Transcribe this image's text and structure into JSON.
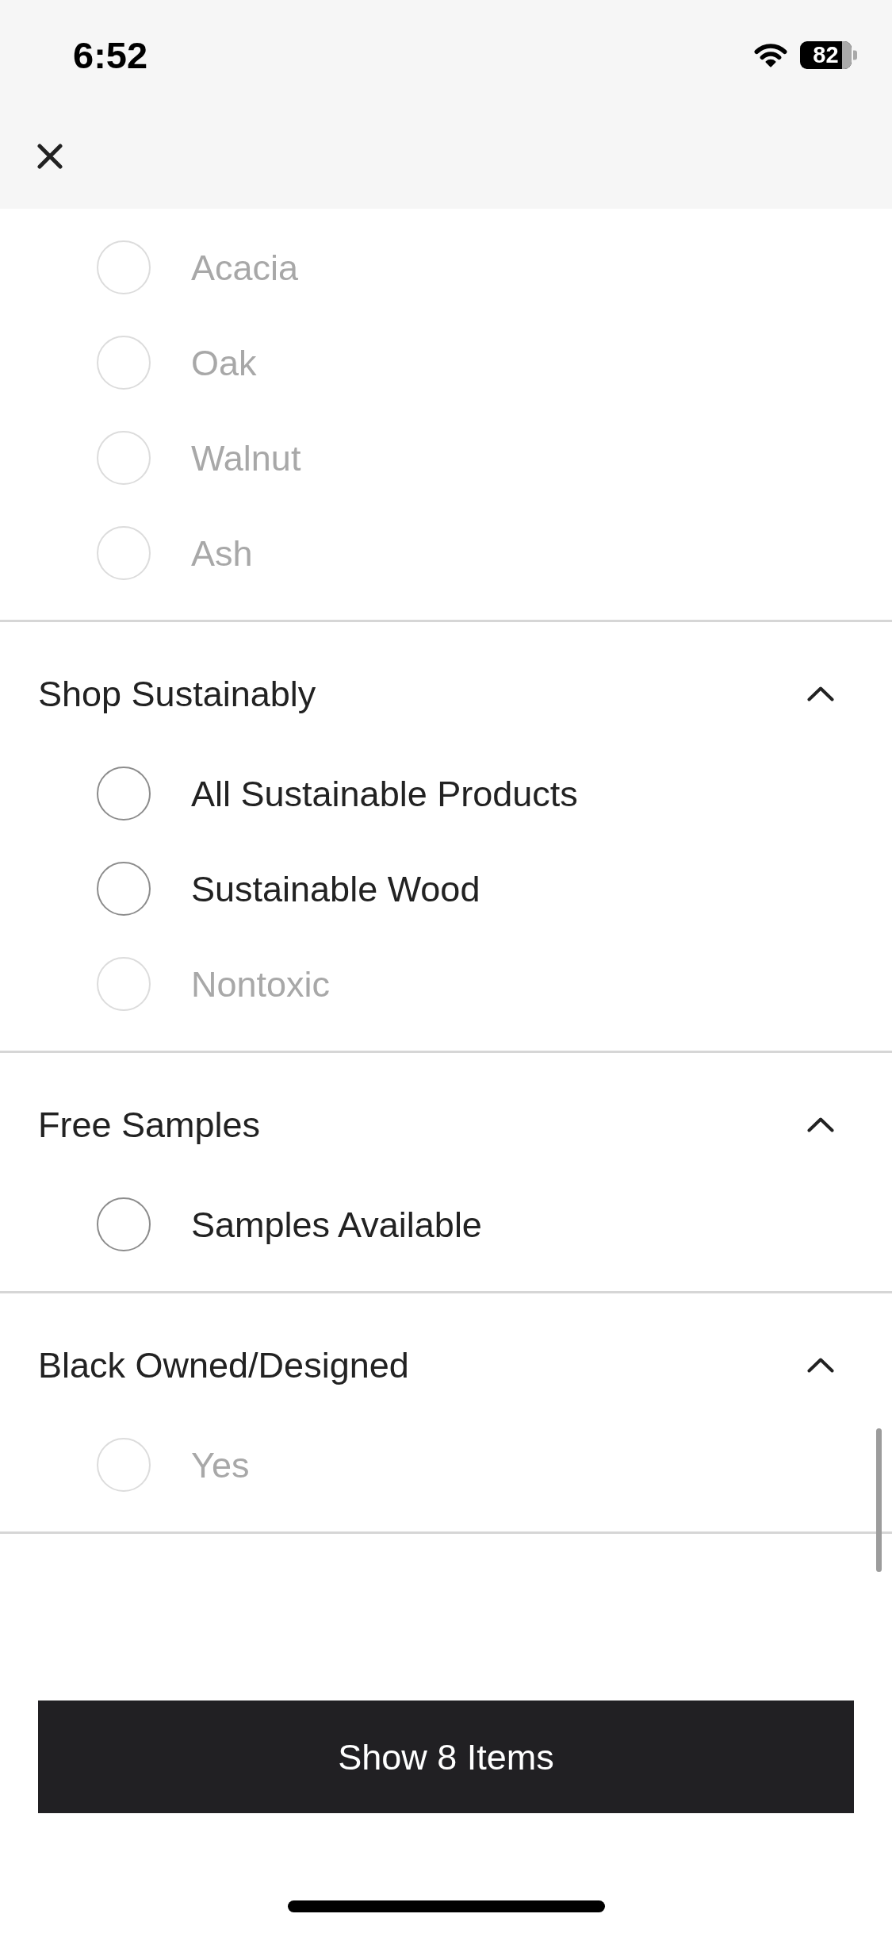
{
  "status_bar": {
    "time": "6:52",
    "battery": "82"
  },
  "sections": [
    {
      "items": [
        {
          "label": "Acacia",
          "checked": false,
          "disabled": true
        },
        {
          "label": "Oak",
          "checked": false,
          "disabled": true
        },
        {
          "label": "Walnut",
          "checked": false,
          "disabled": true
        },
        {
          "label": "Ash",
          "checked": false,
          "disabled": true
        }
      ]
    },
    {
      "title": "Shop Sustainably",
      "expanded": true,
      "items": [
        {
          "label": "All Sustainable Products",
          "checked": false,
          "disabled": false
        },
        {
          "label": "Sustainable Wood",
          "checked": false,
          "disabled": false
        },
        {
          "label": "Nontoxic",
          "checked": false,
          "disabled": true
        }
      ]
    },
    {
      "title": "Free Samples",
      "expanded": true,
      "items": [
        {
          "label": "Samples Available",
          "checked": false,
          "disabled": false
        }
      ]
    },
    {
      "title": "Black Owned/Designed",
      "expanded": true,
      "items": [
        {
          "label": "Yes",
          "checked": false,
          "disabled": true
        }
      ]
    }
  ],
  "primary_button": {
    "label": "Show 8 Items"
  }
}
